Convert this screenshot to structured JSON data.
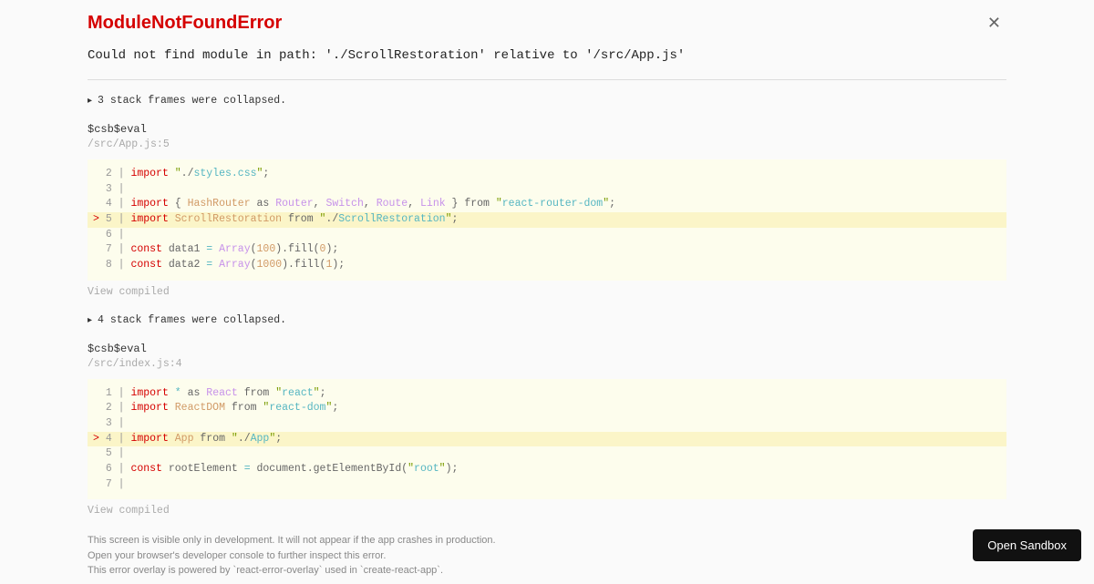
{
  "error": {
    "title": "ModuleNotFoundError",
    "message": "Could not find module in path: './ScrollRestoration' relative to '/src/App.js'"
  },
  "collapsed1": "3 stack frames were collapsed.",
  "frame1": {
    "name": "$csb$eval",
    "location": "/src/App.js:5"
  },
  "code1": {
    "lines": [
      {
        "n": "2",
        "hl": false,
        "html": "<span class='kw'>import</span> <span class='str'>\"</span><span class='punc'>./</span><span class='id2'>styles.css</span><span class='str'>\"</span><span class='punc'>;</span>"
      },
      {
        "n": "3",
        "hl": false,
        "html": ""
      },
      {
        "n": "4",
        "hl": false,
        "html": "<span class='kw'>import</span> <span class='punc'>{</span> <span class='id'>HashRouter</span> <span class='punc'>as</span> <span class='fn'>Router</span><span class='punc'>,</span> <span class='fn'>Switch</span><span class='punc'>,</span> <span class='fn'>Route</span><span class='punc'>,</span> <span class='fn'>Link</span> <span class='punc'>}</span> <span class='punc'>from</span> <span class='str'>\"</span><span class='id2'>react-router-dom</span><span class='str'>\"</span><span class='punc'>;</span>"
      },
      {
        "n": "5",
        "hl": true,
        "html": "<span class='kw'>import</span> <span class='id'>ScrollRestoration</span> <span class='punc'>from</span> <span class='str'>\"</span><span class='punc'>./</span><span class='id2'>ScrollRestoration</span><span class='str'>\"</span><span class='punc'>;</span>"
      },
      {
        "n": "6",
        "hl": false,
        "html": ""
      },
      {
        "n": "7",
        "hl": false,
        "html": "<span class='kw'>const</span> <span class='punc'>data1</span> <span class='op'>=</span> <span class='fn'>Array</span><span class='punc'>(</span><span class='num'>100</span><span class='punc'>).fill(</span><span class='num'>0</span><span class='punc'>);</span>"
      },
      {
        "n": "8",
        "hl": false,
        "html": "<span class='kw'>const</span> <span class='punc'>data2</span> <span class='op'>=</span> <span class='fn'>Array</span><span class='punc'>(</span><span class='num'>1000</span><span class='punc'>).fill(</span><span class='num'>1</span><span class='punc'>);</span>"
      }
    ]
  },
  "viewCompiled": "View compiled",
  "collapsed2": "4 stack frames were collapsed.",
  "frame2": {
    "name": "$csb$eval",
    "location": "/src/index.js:4"
  },
  "code2": {
    "lines": [
      {
        "n": "1",
        "hl": false,
        "html": "<span class='kw'>import</span> <span class='op'>*</span> <span class='punc'>as</span> <span class='fn'>React</span> <span class='punc'>from</span> <span class='str'>\"</span><span class='id2'>react</span><span class='str'>\"</span><span class='punc'>;</span>"
      },
      {
        "n": "2",
        "hl": false,
        "html": "<span class='kw'>import</span> <span class='id'>ReactDOM</span> <span class='punc'>from</span> <span class='str'>\"</span><span class='id2'>react-dom</span><span class='str'>\"</span><span class='punc'>;</span>"
      },
      {
        "n": "3",
        "hl": false,
        "html": ""
      },
      {
        "n": "4",
        "hl": true,
        "html": "<span class='kw'>import</span> <span class='id'>App</span> <span class='punc'>from</span> <span class='str'>\"</span><span class='punc'>./</span><span class='id2'>App</span><span class='str'>\"</span><span class='punc'>;</span>"
      },
      {
        "n": "5",
        "hl": false,
        "html": ""
      },
      {
        "n": "6",
        "hl": false,
        "html": "<span class='kw'>const</span> <span class='punc'>rootElement</span> <span class='op'>=</span> <span class='punc'>document.getElementById(</span><span class='str'>\"</span><span class='id2'>root</span><span class='str'>\"</span><span class='punc'>);</span>"
      },
      {
        "n": "7",
        "hl": false,
        "html": ""
      }
    ]
  },
  "footer": {
    "l1": "This screen is visible only in development. It will not appear if the app crashes in production.",
    "l2": "Open your browser's developer console to further inspect this error.",
    "l3": "This error overlay is powered by `react-error-overlay` used in `create-react-app`."
  },
  "sandbox": "Open Sandbox"
}
